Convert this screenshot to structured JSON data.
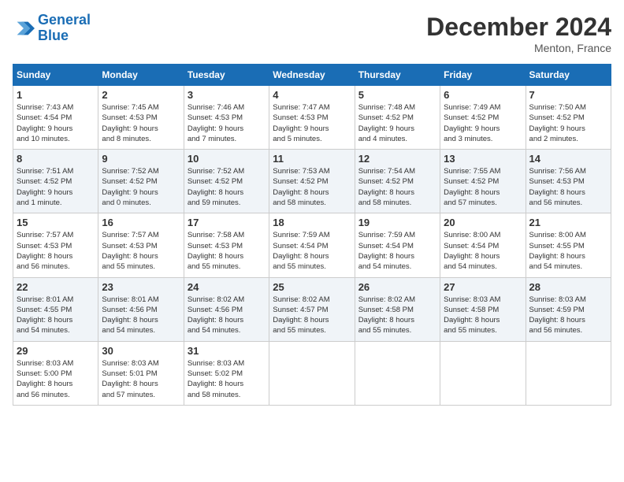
{
  "header": {
    "logo_line1": "General",
    "logo_line2": "Blue",
    "month": "December 2024",
    "location": "Menton, France"
  },
  "days_of_week": [
    "Sunday",
    "Monday",
    "Tuesday",
    "Wednesday",
    "Thursday",
    "Friday",
    "Saturday"
  ],
  "weeks": [
    [
      {
        "day": "1",
        "info": "Sunrise: 7:43 AM\nSunset: 4:54 PM\nDaylight: 9 hours\nand 10 minutes."
      },
      {
        "day": "2",
        "info": "Sunrise: 7:45 AM\nSunset: 4:53 PM\nDaylight: 9 hours\nand 8 minutes."
      },
      {
        "day": "3",
        "info": "Sunrise: 7:46 AM\nSunset: 4:53 PM\nDaylight: 9 hours\nand 7 minutes."
      },
      {
        "day": "4",
        "info": "Sunrise: 7:47 AM\nSunset: 4:53 PM\nDaylight: 9 hours\nand 5 minutes."
      },
      {
        "day": "5",
        "info": "Sunrise: 7:48 AM\nSunset: 4:52 PM\nDaylight: 9 hours\nand 4 minutes."
      },
      {
        "day": "6",
        "info": "Sunrise: 7:49 AM\nSunset: 4:52 PM\nDaylight: 9 hours\nand 3 minutes."
      },
      {
        "day": "7",
        "info": "Sunrise: 7:50 AM\nSunset: 4:52 PM\nDaylight: 9 hours\nand 2 minutes."
      }
    ],
    [
      {
        "day": "8",
        "info": "Sunrise: 7:51 AM\nSunset: 4:52 PM\nDaylight: 9 hours\nand 1 minute."
      },
      {
        "day": "9",
        "info": "Sunrise: 7:52 AM\nSunset: 4:52 PM\nDaylight: 9 hours\nand 0 minutes."
      },
      {
        "day": "10",
        "info": "Sunrise: 7:52 AM\nSunset: 4:52 PM\nDaylight: 8 hours\nand 59 minutes."
      },
      {
        "day": "11",
        "info": "Sunrise: 7:53 AM\nSunset: 4:52 PM\nDaylight: 8 hours\nand 58 minutes."
      },
      {
        "day": "12",
        "info": "Sunrise: 7:54 AM\nSunset: 4:52 PM\nDaylight: 8 hours\nand 58 minutes."
      },
      {
        "day": "13",
        "info": "Sunrise: 7:55 AM\nSunset: 4:52 PM\nDaylight: 8 hours\nand 57 minutes."
      },
      {
        "day": "14",
        "info": "Sunrise: 7:56 AM\nSunset: 4:53 PM\nDaylight: 8 hours\nand 56 minutes."
      }
    ],
    [
      {
        "day": "15",
        "info": "Sunrise: 7:57 AM\nSunset: 4:53 PM\nDaylight: 8 hours\nand 56 minutes."
      },
      {
        "day": "16",
        "info": "Sunrise: 7:57 AM\nSunset: 4:53 PM\nDaylight: 8 hours\nand 55 minutes."
      },
      {
        "day": "17",
        "info": "Sunrise: 7:58 AM\nSunset: 4:53 PM\nDaylight: 8 hours\nand 55 minutes."
      },
      {
        "day": "18",
        "info": "Sunrise: 7:59 AM\nSunset: 4:54 PM\nDaylight: 8 hours\nand 55 minutes."
      },
      {
        "day": "19",
        "info": "Sunrise: 7:59 AM\nSunset: 4:54 PM\nDaylight: 8 hours\nand 54 minutes."
      },
      {
        "day": "20",
        "info": "Sunrise: 8:00 AM\nSunset: 4:54 PM\nDaylight: 8 hours\nand 54 minutes."
      },
      {
        "day": "21",
        "info": "Sunrise: 8:00 AM\nSunset: 4:55 PM\nDaylight: 8 hours\nand 54 minutes."
      }
    ],
    [
      {
        "day": "22",
        "info": "Sunrise: 8:01 AM\nSunset: 4:55 PM\nDaylight: 8 hours\nand 54 minutes."
      },
      {
        "day": "23",
        "info": "Sunrise: 8:01 AM\nSunset: 4:56 PM\nDaylight: 8 hours\nand 54 minutes."
      },
      {
        "day": "24",
        "info": "Sunrise: 8:02 AM\nSunset: 4:56 PM\nDaylight: 8 hours\nand 54 minutes."
      },
      {
        "day": "25",
        "info": "Sunrise: 8:02 AM\nSunset: 4:57 PM\nDaylight: 8 hours\nand 55 minutes."
      },
      {
        "day": "26",
        "info": "Sunrise: 8:02 AM\nSunset: 4:58 PM\nDaylight: 8 hours\nand 55 minutes."
      },
      {
        "day": "27",
        "info": "Sunrise: 8:03 AM\nSunset: 4:58 PM\nDaylight: 8 hours\nand 55 minutes."
      },
      {
        "day": "28",
        "info": "Sunrise: 8:03 AM\nSunset: 4:59 PM\nDaylight: 8 hours\nand 56 minutes."
      }
    ],
    [
      {
        "day": "29",
        "info": "Sunrise: 8:03 AM\nSunset: 5:00 PM\nDaylight: 8 hours\nand 56 minutes."
      },
      {
        "day": "30",
        "info": "Sunrise: 8:03 AM\nSunset: 5:01 PM\nDaylight: 8 hours\nand 57 minutes."
      },
      {
        "day": "31",
        "info": "Sunrise: 8:03 AM\nSunset: 5:02 PM\nDaylight: 8 hours\nand 58 minutes."
      },
      null,
      null,
      null,
      null
    ]
  ]
}
